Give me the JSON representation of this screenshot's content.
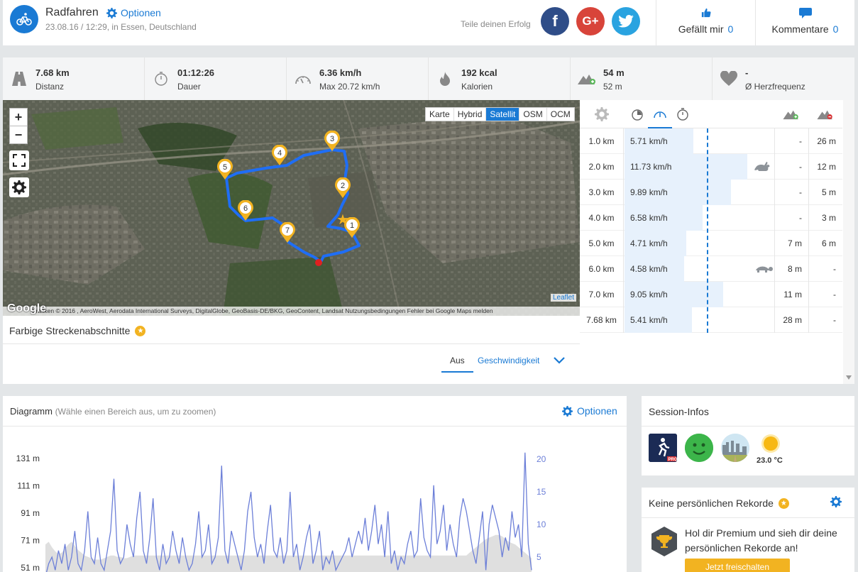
{
  "header": {
    "title": "Radfahren",
    "options_label": "Optionen",
    "subtitle": "23.08.16 / 12:29, in Essen, Deutschland",
    "share_label": "Teile deinen Erfolg",
    "facebook_glyph": "f",
    "google_glyph": "G+",
    "twitter_icon": "twitter-bird-icon",
    "like_label": "Gefällt mir",
    "like_count": "0",
    "comments_label": "Kommentare",
    "comments_count": "0"
  },
  "stats": [
    {
      "icon": "road-icon",
      "value": "7.68 km",
      "label": "Distanz"
    },
    {
      "icon": "stopwatch-icon",
      "value": "01:12:26",
      "label": "Dauer"
    },
    {
      "icon": "speedometer-icon",
      "value": "6.36 km/h",
      "label": "Max 20.72 km/h"
    },
    {
      "icon": "flame-icon",
      "value": "192 kcal",
      "label": "Kalorien"
    },
    {
      "icon": "elevation-icon",
      "value": "54 m",
      "label": "52 m"
    },
    {
      "icon": "heart-icon",
      "value": "-",
      "label": "Ø Herzfrequenz"
    }
  ],
  "map": {
    "layers": [
      "Karte",
      "Hybrid",
      "Satellit",
      "OSM",
      "OCM"
    ],
    "active_layer": "Satellit",
    "zoom_in": "+",
    "zoom_out": "−",
    "markers": [
      "1",
      "2",
      "3",
      "4",
      "5",
      "6",
      "7"
    ],
    "attribution": "Grafiken © 2016 , AeroWest, Aerodata International Surveys, DigitalGlobe, GeoBasis-DE/BKG, GeoContent, Landsat    Nutzungsbedingungen    Fehler bei Google Maps melden",
    "google_logo": "Google",
    "leaflet": "Leaflet"
  },
  "segments": {
    "title": "Farbige Streckenabschnitte",
    "off_label": "Aus",
    "speed_label": "Geschwindigkeit"
  },
  "splits": {
    "rows": [
      {
        "km": "1.0 km",
        "speed": "5.71 km/h",
        "animal": "",
        "up": "-",
        "down": "26 m",
        "frac": 0.46
      },
      {
        "km": "2.0 km",
        "speed": "11.73 km/h",
        "animal": "rabbit",
        "up": "-",
        "down": "12 m",
        "frac": 0.82
      },
      {
        "km": "3.0 km",
        "speed": "9.89 km/h",
        "animal": "",
        "up": "-",
        "down": "5 m",
        "frac": 0.71
      },
      {
        "km": "4.0 km",
        "speed": "6.58 km/h",
        "animal": "",
        "up": "-",
        "down": "3 m",
        "frac": 0.52
      },
      {
        "km": "5.0 km",
        "speed": "4.71 km/h",
        "animal": "",
        "up": "7 m",
        "down": "6 m",
        "frac": 0.41
      },
      {
        "km": "6.0 km",
        "speed": "4.58 km/h",
        "animal": "turtle",
        "up": "8 m",
        "down": "-",
        "frac": 0.4
      },
      {
        "km": "7.0 km",
        "speed": "9.05 km/h",
        "animal": "",
        "up": "11 m",
        "down": "-",
        "frac": 0.66
      },
      {
        "km": "7.68 km",
        "speed": "5.41 km/h",
        "animal": "",
        "up": "28 m",
        "down": "-",
        "frac": 0.45
      }
    ]
  },
  "diagram": {
    "title": "Diagramm",
    "hint": "(Wähle einen Bereich aus, um zu zoomen)",
    "options_label": "Optionen"
  },
  "chart_data": {
    "type": "line",
    "title": "",
    "xlabel": "",
    "ylabel_left": "",
    "ylabel_right": "",
    "y_left_ticks": [
      "131 m",
      "111 m",
      "91 m",
      "71 m",
      "51 m"
    ],
    "y_left_range": [
      51,
      131
    ],
    "y_right_ticks": [
      "20",
      "15",
      "10",
      "5"
    ],
    "y_right_range": [
      5,
      20
    ],
    "series": [
      {
        "values": [
          2,
          4,
          5,
          3,
          6,
          4,
          7,
          3,
          5,
          9,
          4,
          3,
          6,
          12,
          5,
          4,
          8,
          4,
          3,
          6,
          9,
          17,
          6,
          4,
          5,
          10,
          7,
          5,
          11,
          15,
          6,
          4,
          8,
          14,
          5,
          3,
          7,
          4,
          5,
          9,
          6,
          4,
          8,
          5,
          3,
          4,
          7,
          12,
          5,
          6,
          10,
          4,
          5,
          8,
          19,
          6,
          4,
          9,
          7,
          5,
          3,
          6,
          12,
          15,
          8,
          5,
          7,
          4,
          9,
          13,
          6,
          5,
          8,
          4,
          6,
          15,
          5,
          7,
          3,
          5,
          8,
          10,
          4,
          6,
          9,
          3,
          5,
          4,
          6,
          3,
          4,
          5,
          6,
          8,
          5,
          7,
          9,
          7,
          11,
          6,
          9,
          13,
          7,
          10,
          5,
          12,
          4,
          6,
          3,
          5,
          4,
          7,
          9,
          5,
          6,
          14,
          8,
          6,
          5,
          16,
          7,
          9,
          13,
          6,
          10,
          7,
          5,
          11,
          14,
          12,
          9,
          6,
          4,
          8,
          12,
          3,
          10,
          13,
          11,
          9,
          5,
          8,
          6,
          12,
          8,
          10,
          5,
          21,
          7,
          3
        ]
      },
      {
        "values": [
          68,
          70,
          66,
          63,
          61,
          62,
          65,
          68,
          70,
          67,
          64,
          62,
          60,
          59,
          58,
          57,
          57,
          57,
          58,
          59,
          60,
          60,
          59,
          59,
          58,
          58,
          59,
          60,
          60,
          60,
          60,
          60,
          60,
          60,
          60,
          60,
          60,
          60,
          60,
          60,
          60,
          60,
          60,
          60,
          60,
          60,
          60,
          60,
          60,
          60,
          60,
          60,
          60,
          60,
          60,
          60,
          60,
          60,
          60,
          60,
          60,
          60,
          60,
          60,
          60,
          60,
          60,
          60,
          60,
          60,
          60,
          60,
          60,
          60,
          60,
          60,
          60,
          60,
          60,
          60,
          60,
          60,
          60,
          60,
          60,
          60,
          60,
          60,
          60,
          60,
          60,
          60,
          60,
          60,
          60,
          60,
          60,
          60,
          60,
          60,
          60,
          60,
          60,
          60,
          60,
          60,
          60,
          60,
          60,
          60,
          60,
          60,
          60,
          60,
          60,
          60,
          60,
          60,
          60,
          60,
          60,
          60,
          60,
          60,
          60,
          60,
          60,
          60,
          60,
          60,
          62,
          64,
          66,
          68,
          70,
          72,
          73,
          74,
          75,
          75,
          74,
          72,
          70,
          69,
          68,
          66,
          64,
          62,
          60,
          58
        ]
      }
    ],
    "grid": false
  },
  "session": {
    "title": "Session-Infos",
    "app_icon": "runtastic-pro-app-icon",
    "mood_icon": "smiley-happy-icon",
    "surface_icon": "city-road-surface-icon",
    "weather_icon": "sun-icon",
    "temperature": "23.0 °C"
  },
  "records": {
    "title": "Keine persönlichen Rekorde",
    "text": "Hol dir Premium und sieh dir deine persönlichen Rekorde an!",
    "button": "Jetzt freischalten"
  }
}
